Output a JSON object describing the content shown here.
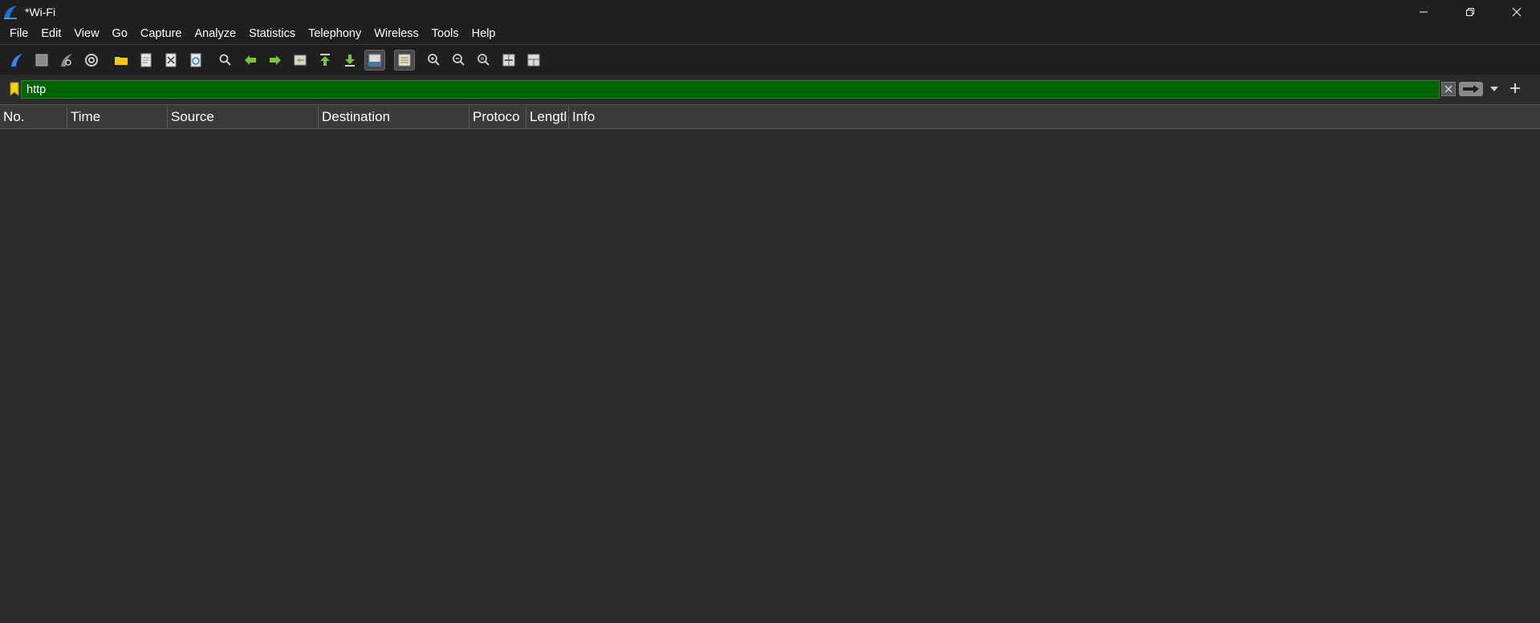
{
  "window": {
    "title": "*Wi-Fi",
    "controls": [
      "minimize",
      "restore",
      "close"
    ]
  },
  "menu": [
    "File",
    "Edit",
    "View",
    "Go",
    "Capture",
    "Analyze",
    "Statistics",
    "Telephony",
    "Wireless",
    "Tools",
    "Help"
  ],
  "toolbar": {
    "icons": [
      "start-capture-icon",
      "stop-capture-icon",
      "restart-capture-icon",
      "capture-options-icon",
      "open-file-icon",
      "save-file-icon",
      "close-file-icon",
      "reload-file-icon",
      "find-packet-icon",
      "go-back-icon",
      "go-forward-icon",
      "go-to-packet-icon",
      "first-packet-icon",
      "last-packet-icon",
      "auto-scroll-icon",
      "colorize-icon",
      "zoom-in-icon",
      "zoom-out-icon",
      "normal-size-icon",
      "resize-columns-icon",
      "layout-icon"
    ]
  },
  "filter": {
    "value": "http",
    "valid_color": "#006400"
  },
  "packet_list": {
    "columns": [
      "No.",
      "Time",
      "Source",
      "Destination",
      "Protoco",
      "Lengtl",
      "Info"
    ],
    "rows": []
  }
}
